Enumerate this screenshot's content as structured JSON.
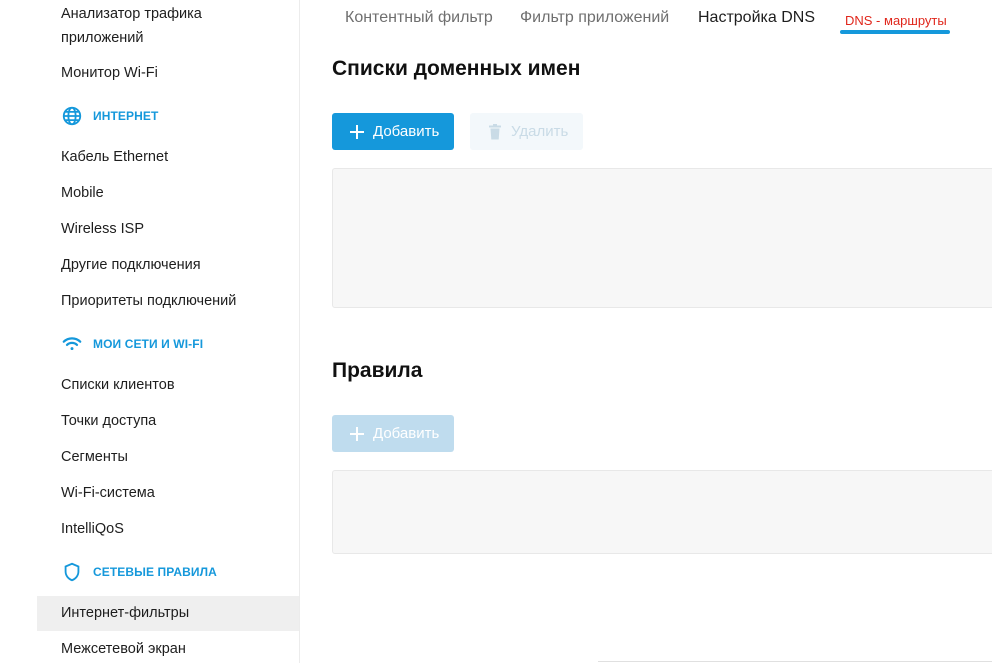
{
  "tabs": [
    {
      "label": "Контентный фильтр"
    },
    {
      "label": "Фильтр приложений"
    },
    {
      "label": "Настройка DNS"
    },
    {
      "label": "DNS - маршруты"
    }
  ],
  "sidebar": {
    "items_top": [
      {
        "label": "Анализатор трафика\nприложений"
      },
      {
        "label": "Монитор Wi-Fi"
      }
    ],
    "sections": {
      "internet": {
        "title": "ИНТЕРНЕТ",
        "icon": "globe-icon"
      },
      "networks": {
        "title": "МОИ СЕТИ И WI-FI",
        "icon": "wifi-icon"
      },
      "rules": {
        "title": "СЕТЕВЫЕ ПРАВИЛА",
        "icon": "shield-icon"
      }
    },
    "internet_items": [
      {
        "label": "Кабель Ethernet"
      },
      {
        "label": "Mobile"
      },
      {
        "label": "Wireless ISP"
      },
      {
        "label": "Другие подключения"
      },
      {
        "label": "Приоритеты подключений"
      }
    ],
    "network_items": [
      {
        "label": "Списки клиентов"
      },
      {
        "label": "Точки доступа"
      },
      {
        "label": "Сегменты"
      },
      {
        "label": "Wi-Fi-система"
      },
      {
        "label": "IntelliQoS"
      }
    ],
    "rules_items": [
      {
        "label": "Интернет-фильтры",
        "active": true
      },
      {
        "label": "Межсетевой экран"
      }
    ]
  },
  "main": {
    "domain_lists": {
      "title": "Списки доменных имен",
      "add_label": "Добавить",
      "delete_label": "Удалить"
    },
    "rules": {
      "title": "Правила",
      "add_label": "Добавить"
    }
  },
  "colors": {
    "accent": "#1598db",
    "active_tab_red": "#e0261b",
    "active_sidebar_bg": "#efefef"
  }
}
